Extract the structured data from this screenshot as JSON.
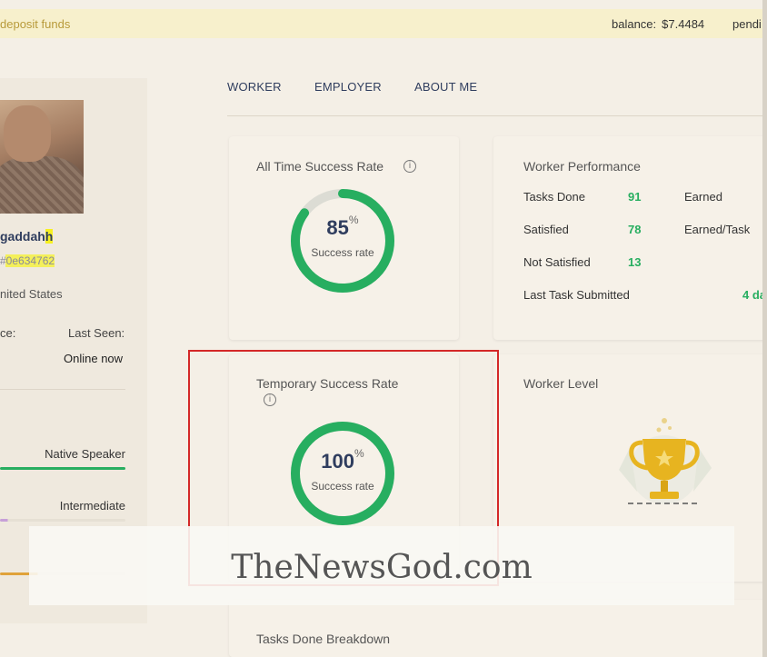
{
  "topbar": {
    "deposit_label": "deposit funds",
    "balance_label": "balance:",
    "balance_value": "$7.4484",
    "pending_label": "pendi"
  },
  "profile": {
    "username": "gaddah",
    "username_tail": "h",
    "user_id": "#0e634762",
    "country": "nited States",
    "since_label": "ce:",
    "last_seen_label": "Last Seen:",
    "last_seen_value": "Online now",
    "languages": [
      {
        "level": "Native Speaker",
        "color": "#27ae60",
        "fill": 1.0
      },
      {
        "level": "Intermediate",
        "color": "#c7a0d8",
        "fill": 0.06
      },
      {
        "level": "",
        "color": "#e0a23a",
        "fill": 0.3
      }
    ]
  },
  "tabs": [
    {
      "label": "WORKER",
      "active": true
    },
    {
      "label": "EMPLOYER",
      "active": false
    },
    {
      "label": "ABOUT ME",
      "active": false
    }
  ],
  "all_time": {
    "title": "All Time Success Rate",
    "value": "85",
    "percent_sign": "%",
    "label": "Success rate",
    "fraction": 0.85
  },
  "performance": {
    "title": "Worker Performance",
    "tasks_done_label": "Tasks Done",
    "tasks_done_value": "91",
    "satisfied_label": "Satisfied",
    "satisfied_value": "78",
    "not_satisfied_label": "Not Satisfied",
    "not_satisfied_value": "13",
    "last_task_label": "Last Task Submitted",
    "last_task_value": "4 da",
    "earned_label": "Earned",
    "earned_per_task_label": "Earned/Task"
  },
  "temporary": {
    "title": "Temporary Success Rate",
    "value": "100",
    "percent_sign": "%",
    "label": "Success rate",
    "fraction": 1.0
  },
  "level": {
    "title": "Worker Level"
  },
  "breakdown": {
    "title": "Tasks Done Breakdown"
  },
  "watermark": {
    "text": "TheNewsGod.com"
  },
  "colors": {
    "green": "#27ae60",
    "ring_track": "#dcdcd4",
    "highlight": "#d42828",
    "trophy": "#e7b420"
  }
}
